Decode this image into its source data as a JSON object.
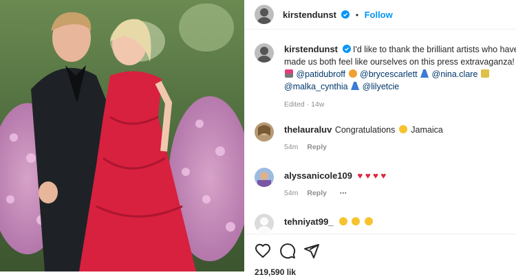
{
  "post": {
    "author": "kirstendunst",
    "follow_label": "Follow",
    "separator": "•",
    "caption": {
      "line1": "I'd like to thank the brilliant artists who have",
      "line2": "made us both feel like ourselves on this press extravaganza!",
      "mentions": [
        "@patidubroff",
        "@brycescarlett",
        "@nina.clare",
        "@malka_cynthia",
        "@lilyetcie"
      ],
      "meta": "Edited · 14w"
    },
    "likes_partial": "219,590 lik"
  },
  "comments": [
    {
      "user": "thelauraluv",
      "text_before": "Congratulations",
      "text_after": "Jamaica",
      "time": "54m",
      "reply": "Reply"
    },
    {
      "user": "alyssanicole109",
      "time": "54m",
      "reply": "Reply",
      "more": "···"
    },
    {
      "user": "tehniyat99_"
    }
  ],
  "colors": {
    "link_blue": "#0095f6",
    "mention_blue": "#00376b",
    "dress_red": "#d8203f"
  }
}
